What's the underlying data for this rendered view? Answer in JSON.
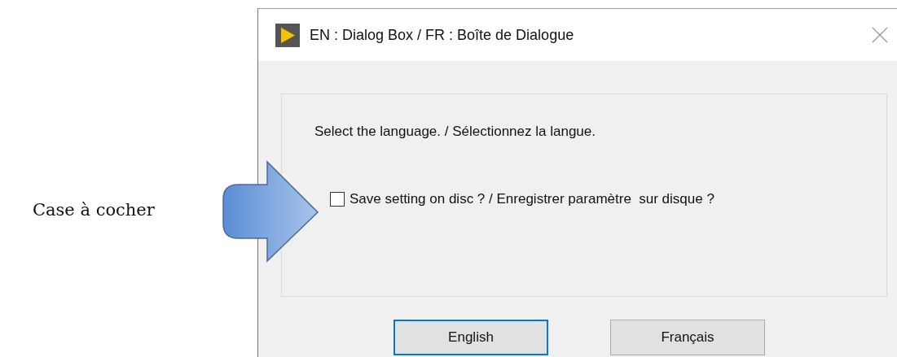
{
  "annotation": {
    "caption": "Case à cocher"
  },
  "window": {
    "title": "EN : Dialog Box / FR : Boîte de Dialogue"
  },
  "prompt": "Select the language. / Sélectionnez la langue.",
  "checkbox": {
    "label": "Save setting on disc ? / Enregistrer paramètre  sur disque ?",
    "checked": false
  },
  "buttons": [
    {
      "label": "English",
      "focused": true
    },
    {
      "label": "Français",
      "focused": false
    }
  ]
}
